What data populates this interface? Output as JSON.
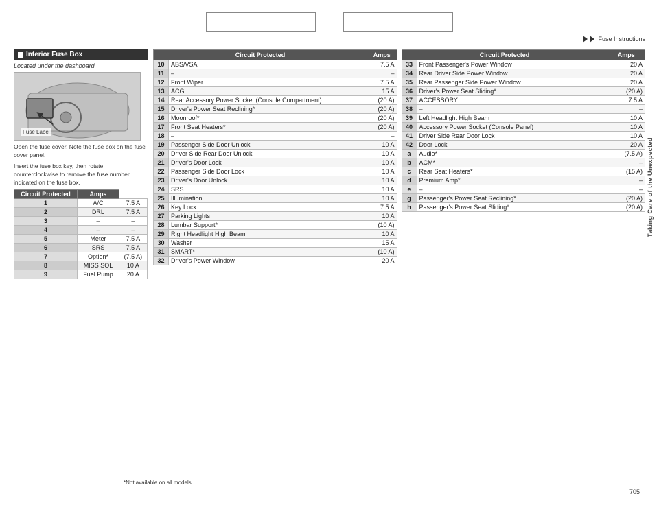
{
  "header": {
    "box1_label": "",
    "box2_label": "",
    "nav_text": "▶ ▶ Fuse Instructions"
  },
  "side_label": "Taking Care of the Unexpected",
  "page_number": "705",
  "footnote": "*Not available on all models",
  "interior_fuse_box": {
    "title": "Interior Fuse Box",
    "location_text": "Located under the dashboard.",
    "fuse_label": "Fuse Label",
    "description1": "Open the fuse cover. Note the fuse box on the fuse cover panel.",
    "description2": "Insert the fuse box key, then rotate counterclockwise to remove the fuse number indicated on the fuse box.",
    "small_table": {
      "headers": [
        "Circuit Protected",
        "Amps"
      ],
      "rows": [
        [
          "1",
          "A/C",
          "7.5 A"
        ],
        [
          "2",
          "DRL",
          "7.5 A"
        ],
        [
          "3",
          "–",
          "–"
        ],
        [
          "4",
          "–",
          "–"
        ],
        [
          "5",
          "Meter",
          "7.5 A"
        ],
        [
          "6",
          "SRS",
          "7.5 A"
        ],
        [
          "7",
          "Option*",
          "(7.5 A)"
        ],
        [
          "8",
          "MISS SOL",
          "10 A"
        ],
        [
          "9",
          "Fuel Pump",
          "20 A"
        ]
      ]
    }
  },
  "middle_table": {
    "headers": [
      "Circuit Protected",
      "Amps"
    ],
    "rows": [
      [
        "10",
        "ABS/VSA",
        "7.5 A"
      ],
      [
        "11",
        "–",
        "–"
      ],
      [
        "12",
        "Front Wiper",
        "7.5 A"
      ],
      [
        "13",
        "ACG",
        "15 A"
      ],
      [
        "14",
        "Rear Accessory Power Socket (Console Compartment)",
        "(20 A)"
      ],
      [
        "15",
        "Driver's Power Seat Reclining*",
        "(20 A)"
      ],
      [
        "16",
        "Moonroof*",
        "(20 A)"
      ],
      [
        "17",
        "Front Seat Heaters*",
        "(20 A)"
      ],
      [
        "18",
        "–",
        "–"
      ],
      [
        "19",
        "Passenger Side Door Unlock",
        "10 A"
      ],
      [
        "20",
        "Driver Side Rear Door Unlock",
        "10 A"
      ],
      [
        "21",
        "Driver's Door Lock",
        "10 A"
      ],
      [
        "22",
        "Passenger Side Door Lock",
        "10 A"
      ],
      [
        "23",
        "Driver's Door Unlock",
        "10 A"
      ],
      [
        "24",
        "SRS",
        "10 A"
      ],
      [
        "25",
        "Illumination",
        "10 A"
      ],
      [
        "26",
        "Key Lock",
        "7.5 A"
      ],
      [
        "27",
        "Parking Lights",
        "10 A"
      ],
      [
        "28",
        "Lumbar Support*",
        "(10 A)"
      ],
      [
        "29",
        "Right Headlight High Beam",
        "10 A"
      ],
      [
        "30",
        "Washer",
        "15 A"
      ],
      [
        "31",
        "SMART*",
        "(10 A)"
      ],
      [
        "32",
        "Driver's Power Window",
        "20 A"
      ]
    ]
  },
  "right_table": {
    "headers": [
      "Circuit Protected",
      "Amps"
    ],
    "rows": [
      [
        "33",
        "Front Passenger's Power Window",
        "20 A"
      ],
      [
        "34",
        "Rear Driver Side Power Window",
        "20 A"
      ],
      [
        "35",
        "Rear Passenger Side Power Window",
        "20 A"
      ],
      [
        "36",
        "Driver's Power Seat Sliding*",
        "(20 A)"
      ],
      [
        "37",
        "ACCESSORY",
        "7.5 A"
      ],
      [
        "38",
        "–",
        "–"
      ],
      [
        "39",
        "Left Headlight High Beam",
        "10 A"
      ],
      [
        "40",
        "Accessory Power Socket (Console Panel)",
        "10 A"
      ],
      [
        "41",
        "Driver Side Rear Door Lock",
        "10 A"
      ],
      [
        "42",
        "Door Lock",
        "20 A"
      ],
      [
        "a",
        "Audio*",
        "(7.5 A)"
      ],
      [
        "b",
        "ACM*",
        "–"
      ],
      [
        "c",
        "Rear Seat Heaters*",
        "(15 A)"
      ],
      [
        "d",
        "Premium Amp*",
        "–"
      ],
      [
        "e",
        "–",
        "–"
      ],
      [
        "g",
        "Passenger's Power Seat Reclining*",
        "(20 A)"
      ],
      [
        "h",
        "Passenger's Power Seat Sliding*",
        "(20 A)"
      ]
    ]
  }
}
